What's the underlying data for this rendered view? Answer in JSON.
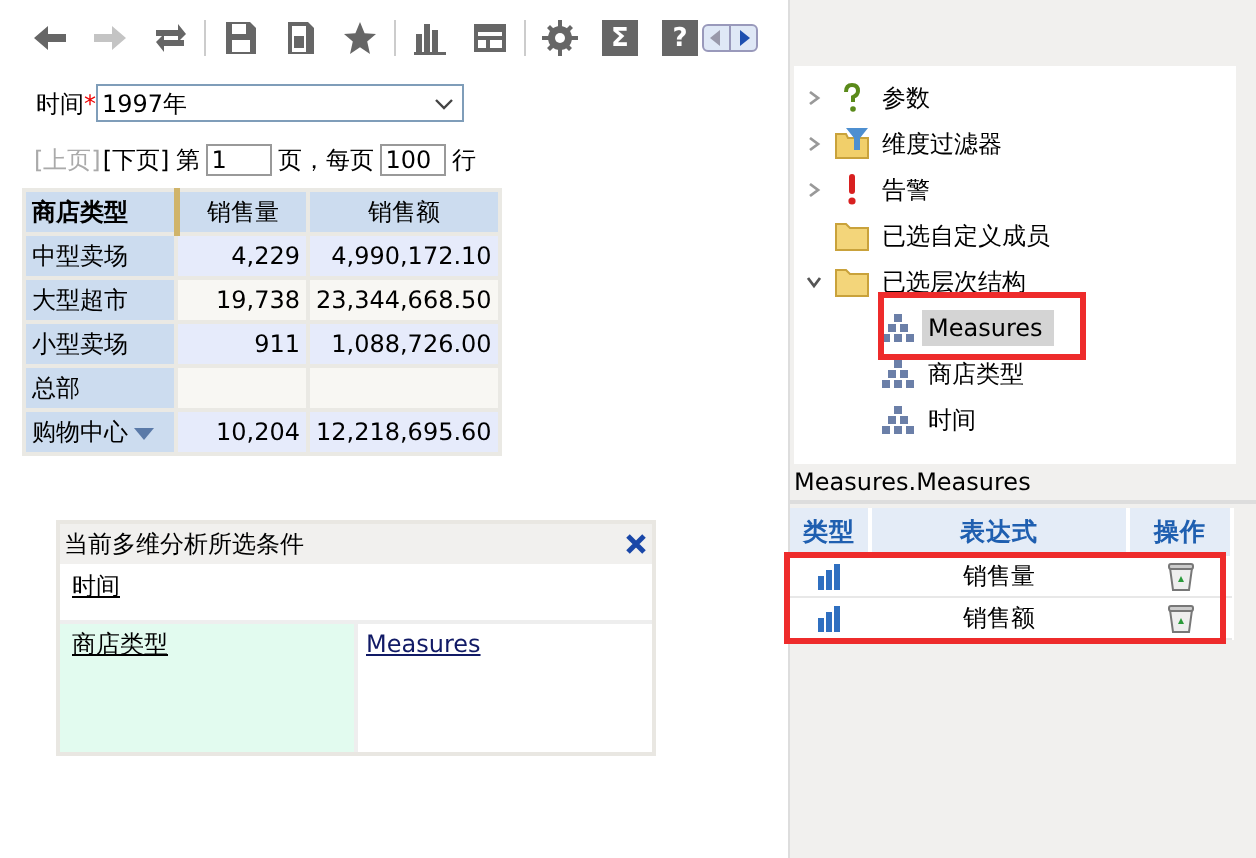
{
  "toolbar": {
    "groups": [
      [
        {
          "kind": "back",
          "disabled": false
        },
        {
          "kind": "forward",
          "disabled": true
        },
        {
          "kind": "refresh",
          "disabled": false
        }
      ],
      [
        {
          "kind": "save",
          "disabled": false
        },
        {
          "kind": "save-as",
          "disabled": false
        },
        {
          "kind": "favorite",
          "disabled": false
        }
      ],
      [
        {
          "kind": "chart",
          "disabled": false
        },
        {
          "kind": "layout",
          "disabled": false
        }
      ],
      [
        {
          "kind": "settings",
          "disabled": false
        },
        {
          "kind": "glyph",
          "glyph": "Σ",
          "disabled": false
        },
        {
          "kind": "glyph",
          "glyph": "?",
          "disabled": false
        }
      ]
    ]
  },
  "filter": {
    "label": "时间",
    "required_mark": "*",
    "value": "1997年"
  },
  "pager": {
    "prev": {
      "label": "[上页]",
      "disabled": true
    },
    "next": {
      "label": "[下页]",
      "disabled": false
    },
    "page_prefix": "第",
    "page": "1",
    "page_suffix": "页，每页",
    "per_page": "100",
    "per_page_suffix": "行"
  },
  "table": {
    "columns": [
      "商店类型",
      "销售量",
      "销售额"
    ],
    "rows": [
      {
        "cells": [
          "中型卖场",
          "4,229",
          "4,990,172.10"
        ],
        "menu": false
      },
      {
        "cells": [
          "大型超市",
          "19,738",
          "23,344,668.50"
        ],
        "menu": false
      },
      {
        "cells": [
          "小型卖场",
          "911",
          "1,088,726.00"
        ],
        "menu": false
      },
      {
        "cells": [
          "总部",
          "",
          ""
        ],
        "menu": false
      },
      {
        "cells": [
          "购物中心",
          "10,204",
          "12,218,695.60"
        ],
        "menu": true
      }
    ]
  },
  "conditions": {
    "title": "当前多维分析所选条件",
    "filter_item": "时间",
    "row_item": "商店类型",
    "column_item": "Measures"
  },
  "tree": [
    {
      "label": "参数",
      "kind": "question",
      "expanded": false
    },
    {
      "label": "维度过滤器",
      "kind": "filter",
      "expanded": false
    },
    {
      "label": "告警",
      "kind": "alert",
      "expanded": false
    },
    {
      "label": "已选自定义成员",
      "kind": "folder"
    },
    {
      "label": "已选层次结构",
      "kind": "folder",
      "expanded": true,
      "children": [
        {
          "label": "Measures",
          "selected": true,
          "highlighted": true
        },
        {
          "label": "商店类型",
          "selected": false,
          "highlighted": false
        },
        {
          "label": "时间",
          "selected": false,
          "highlighted": false
        }
      ]
    }
  ],
  "detail": {
    "title": "Measures.Measures",
    "columns": [
      "类型",
      "表达式",
      "操作"
    ],
    "rows": [
      {
        "expression": "销售量"
      },
      {
        "expression": "销售额"
      }
    ],
    "rows_highlighted": true
  }
}
